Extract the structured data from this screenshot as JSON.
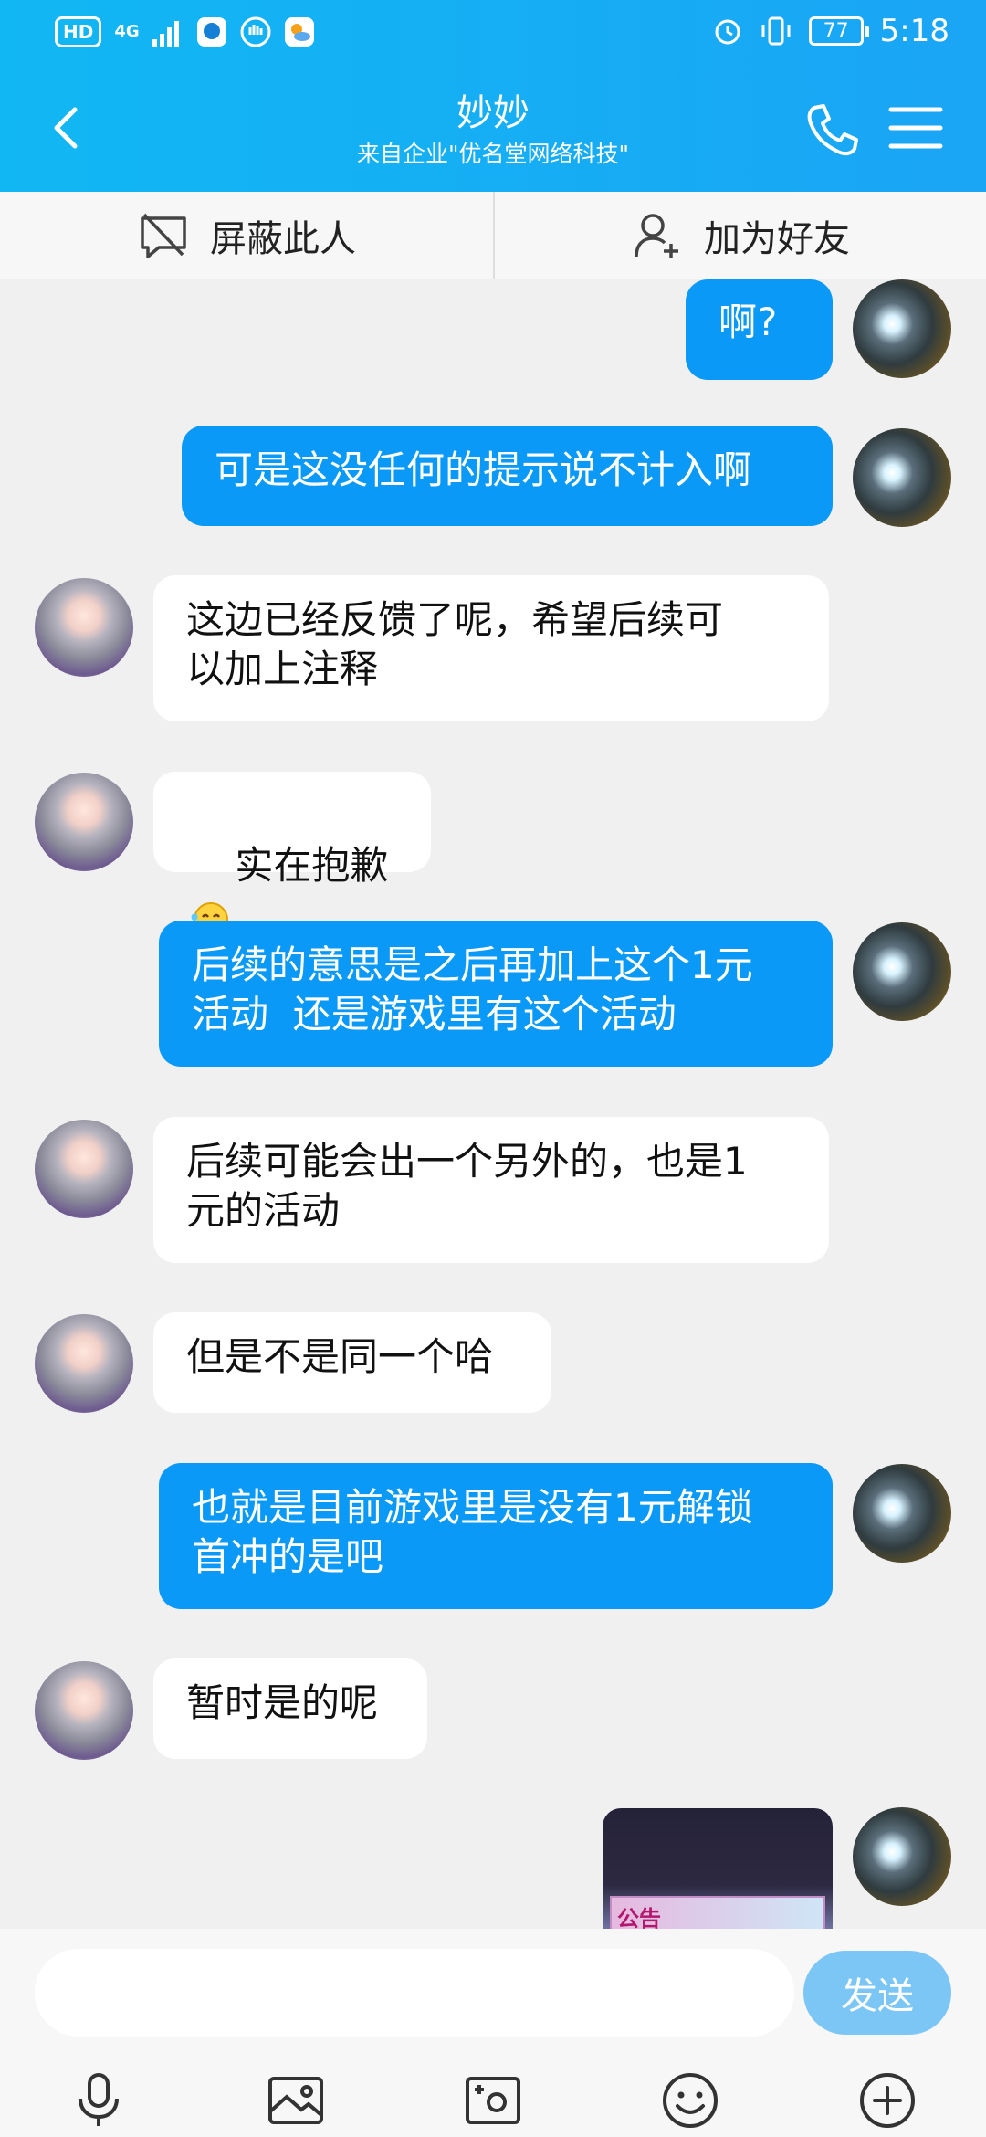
{
  "status_bar": {
    "time": "5:18",
    "battery": "77",
    "hd_label": "HD",
    "network_label": "4G"
  },
  "header": {
    "title": "妙妙",
    "subtitle": "来自企业\"优名堂网络科技\""
  },
  "actions": {
    "block_label": "屏蔽此人",
    "add_friend_label": "加为好友"
  },
  "messages": [
    {
      "from": "self",
      "text": "啊?"
    },
    {
      "from": "self",
      "text": "可是这没任何的提示说不计入啊"
    },
    {
      "from": "other",
      "text": "这边已经反馈了呢，希望后续可\n以加上注释"
    },
    {
      "from": "other",
      "text": "实在抱歉"
    },
    {
      "from": "self",
      "text": "后续的意思是之后再加上这个1元\n活动  还是游戏里有这个活动"
    },
    {
      "from": "other",
      "text": "后续可能会出一个另外的，也是1\n元的活动"
    },
    {
      "from": "other",
      "text": "但是不是同一个哈"
    },
    {
      "from": "self",
      "text": "也就是目前游戏里是没有1元解锁\n首冲的是吧"
    },
    {
      "from": "other",
      "text": "暂时是的呢"
    }
  ],
  "image_message": {
    "label": "公告"
  },
  "input": {
    "placeholder": "",
    "send_label": "发送"
  },
  "icons": {
    "back": "back-chevron-icon",
    "call": "phone-icon",
    "menu": "menu-icon",
    "block": "block-icon",
    "add_friend": "add-user-icon",
    "voice": "microphone-icon",
    "image": "image-icon",
    "camera": "camera-icon",
    "emoji": "emoji-icon",
    "more": "plus-icon"
  },
  "colors": {
    "header": "#11b7f3",
    "self_bubble": "#0a99f7",
    "send_button": "#7cc6f5"
  }
}
